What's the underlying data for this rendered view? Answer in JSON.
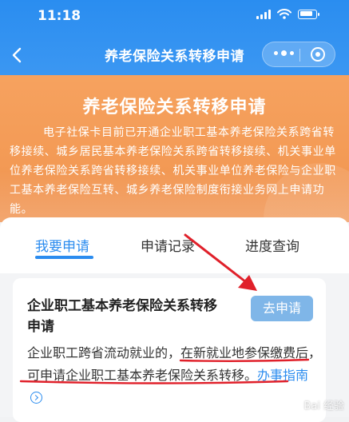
{
  "status_bar": {
    "time": "11:18"
  },
  "nav": {
    "title": "养老保险关系转移申请"
  },
  "banner": {
    "title": "养老保险关系转移申请",
    "description": "电子社保卡目前已开通企业职工基本养老保险关系跨省转移接续、城乡居民基本养老保险关系跨省转移接续、机关事业单位养老保险关系跨省转移接续、机关事业单位养老保险与企业职工基本养老保险互转、城乡养老保险制度衔接业务网上申请功能。"
  },
  "tabs": [
    {
      "label": "我要申请",
      "active": true
    },
    {
      "label": "申请记录",
      "active": false
    },
    {
      "label": "进度查询",
      "active": false
    }
  ],
  "card": {
    "title": "企业职工基本养老保险关系转移申请",
    "apply_label": "去申请",
    "desc_part1": "企业职工跨省流动就业的，",
    "desc_part2": "在新就业地参保缴费后，可申请企业职工基本养老保险关系转移。",
    "guide_label": "办事指南"
  },
  "watermark": "Bai 经验",
  "colors": {
    "nav_blue": "#2a8df0",
    "banner_orange": "#f39a55",
    "accent_blue": "#2b8cef",
    "button_blue": "#7fb6e8",
    "annotation_red": "#e0202a"
  }
}
